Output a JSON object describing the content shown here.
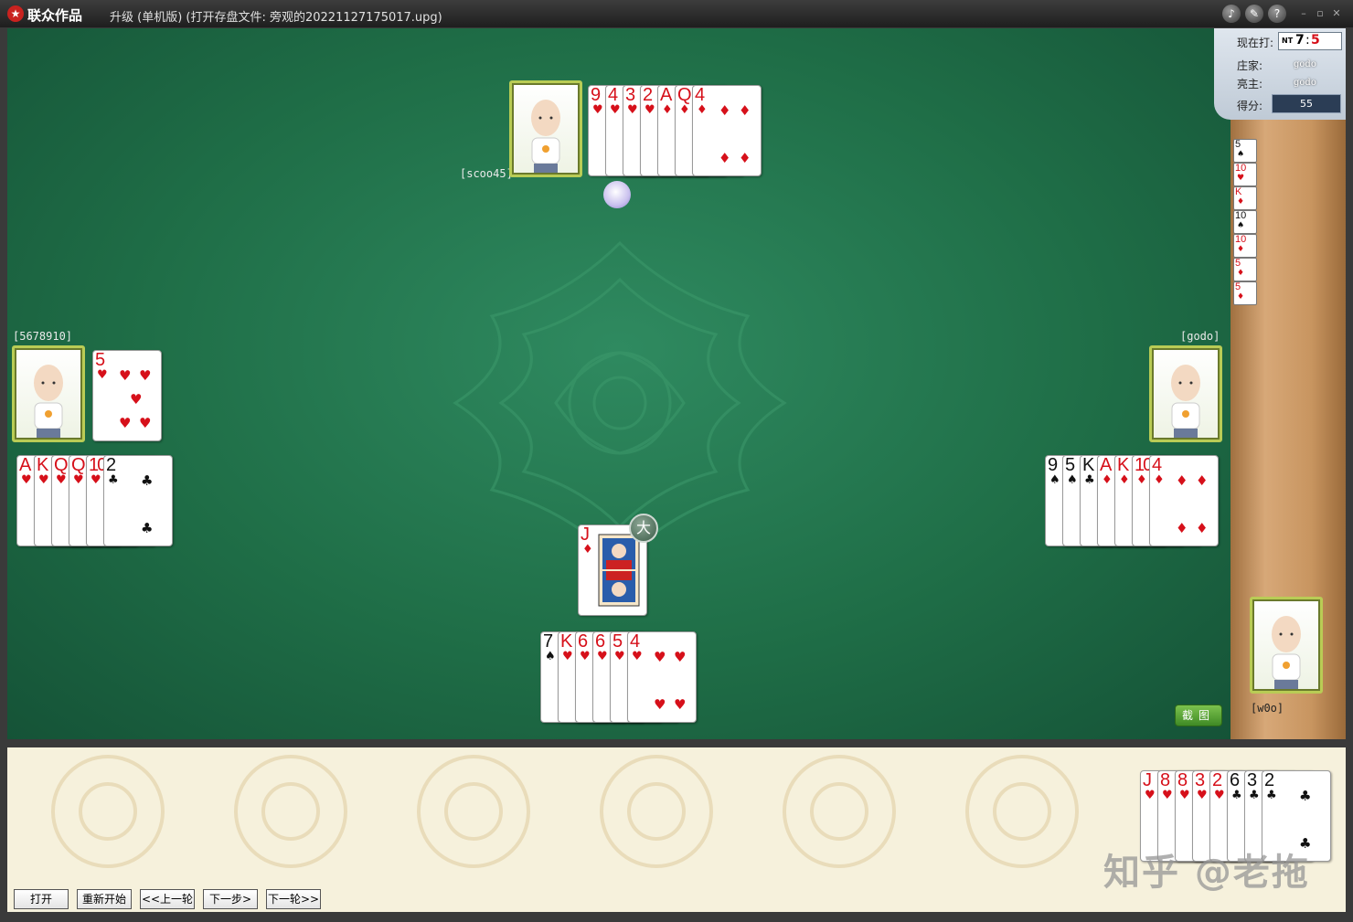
{
  "title_bar": {
    "app_name": "联众作品",
    "window_title": "升级 (单机版) (打开存盘文件: 旁观的20221127175017.upg)",
    "icons": [
      "speaker-icon",
      "wrench-icon",
      "help-icon"
    ],
    "window_buttons": [
      "minimize",
      "restore",
      "close"
    ]
  },
  "info_panel": {
    "current_label": "现在打:",
    "trump_badge": "NT",
    "level_a": "7",
    "level_sep": ":",
    "level_b": "5",
    "dealer_label": "庄家:",
    "dealer_value": "godo",
    "declarer_label": "亮主:",
    "declarer_value": "godo",
    "score_label": "得分:",
    "score_value": "55",
    "score_cards": [
      {
        "rank": "5",
        "suit": "♠",
        "color": "black"
      },
      {
        "rank": "10",
        "suit": "♥",
        "color": "red"
      },
      {
        "rank": "K",
        "suit": "♦",
        "color": "red"
      },
      {
        "rank": "10",
        "suit": "♠",
        "color": "black"
      },
      {
        "rank": "10",
        "suit": "♦",
        "color": "red"
      },
      {
        "rank": "5",
        "suit": "♦",
        "color": "red"
      },
      {
        "rank": "5",
        "suit": "♦",
        "color": "red"
      }
    ]
  },
  "players": {
    "north": {
      "name": "[scoo45]",
      "cards": [
        {
          "rank": "9",
          "suit": "♥"
        },
        {
          "rank": "4",
          "suit": "♥"
        },
        {
          "rank": "3",
          "suit": "♥"
        },
        {
          "rank": "2",
          "suit": "♥"
        },
        {
          "rank": "A",
          "suit": "♦"
        },
        {
          "rank": "Q",
          "suit": "♦"
        },
        {
          "rank": "4",
          "suit": "♦"
        }
      ]
    },
    "west": {
      "name": "[5678910]",
      "last_played": {
        "rank": "5",
        "suit": "♥"
      },
      "cards": [
        {
          "rank": "A",
          "suit": "♥"
        },
        {
          "rank": "K",
          "suit": "♥"
        },
        {
          "rank": "Q",
          "suit": "♥"
        },
        {
          "rank": "Q",
          "suit": "♥"
        },
        {
          "rank": "10",
          "suit": "♥"
        },
        {
          "rank": "2",
          "suit": "♣"
        }
      ]
    },
    "east": {
      "name": "[godo]",
      "cards": [
        {
          "rank": "9",
          "suit": "♠"
        },
        {
          "rank": "5",
          "suit": "♠"
        },
        {
          "rank": "K",
          "suit": "♣"
        },
        {
          "rank": "A",
          "suit": "♦"
        },
        {
          "rank": "K",
          "suit": "♦"
        },
        {
          "rank": "10",
          "suit": "♦"
        },
        {
          "rank": "4",
          "suit": "♦"
        }
      ]
    },
    "south": {
      "name": "[w0o]",
      "cards": [
        {
          "rank": "7",
          "suit": "♠"
        },
        {
          "rank": "K",
          "suit": "♥"
        },
        {
          "rank": "6",
          "suit": "♥"
        },
        {
          "rank": "6",
          "suit": "♥"
        },
        {
          "rank": "5",
          "suit": "♥"
        },
        {
          "rank": "4",
          "suit": "♥"
        }
      ]
    }
  },
  "center_played": {
    "rank": "J",
    "suit": "♦",
    "badge": "大"
  },
  "screenshot_button": "截图",
  "my_hand": [
    {
      "rank": "J",
      "suit": "♥"
    },
    {
      "rank": "8",
      "suit": "♥"
    },
    {
      "rank": "8",
      "suit": "♥"
    },
    {
      "rank": "3",
      "suit": "♥"
    },
    {
      "rank": "2",
      "suit": "♥"
    },
    {
      "rank": "6",
      "suit": "♣"
    },
    {
      "rank": "3",
      "suit": "♣"
    },
    {
      "rank": "2",
      "suit": "♣"
    }
  ],
  "controls": {
    "open": "打开",
    "restart": "重新开始",
    "prev_round": "<<上一轮",
    "next_step": "下一步>",
    "next_round": "下一轮>>"
  },
  "watermark": "知乎 @老拖"
}
